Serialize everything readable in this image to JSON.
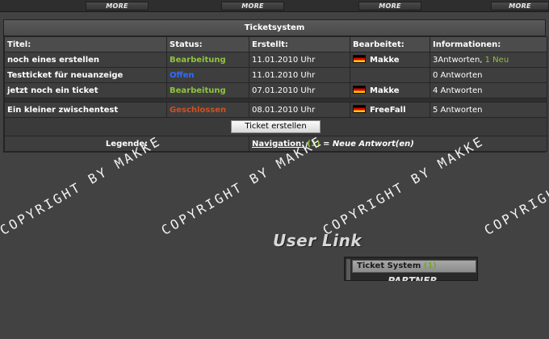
{
  "top_bar": {
    "more_buttons": [
      "MORE",
      "MORE",
      "MORE",
      "MORE"
    ]
  },
  "ticketsystem": {
    "title": "Ticketsystem",
    "columns": [
      "Titel:",
      "Status:",
      "Erstellt:",
      "Bearbeitet:",
      "Informationen:"
    ],
    "rows": [
      {
        "title": "noch eines erstellen",
        "status": "Bearbeitung",
        "created": "11.01.2010 Uhr",
        "editor": "Makke",
        "info": "3Antworten, ",
        "info_new": "1 Neu"
      },
      {
        "title": "Testticket für neuanzeige",
        "status": "Offen",
        "created": "11.01.2010 Uhr",
        "editor": "",
        "info": "0 Antworten",
        "info_new": ""
      },
      {
        "title": "jetzt noch ein ticket",
        "status": "Bearbeitung",
        "created": "07.01.2010 Uhr",
        "editor": "Makke",
        "info": "4 Antworten",
        "info_new": ""
      },
      {
        "title": "Ein kleiner zwischentest",
        "status": "Geschlossen",
        "created": "08.01.2010 Uhr",
        "editor": "FreeFall",
        "info": "5 Antworten",
        "info_new": ""
      }
    ],
    "create_button": "Ticket erstellen",
    "legend_label": "Legende:",
    "legend_nav": "Navigation:",
    "legend_count": "(1)",
    "legend_eq": " = ",
    "legend_new": "Neue Antwort(en)"
  },
  "watermark": "COPYRIGHT BY MAKKE",
  "user_link": {
    "heading": "User Link",
    "item_label": "Ticket System ",
    "item_count": "(1)",
    "partner": "PARTNER"
  },
  "colors": {
    "status_bearbeitung": "#8fc43c",
    "status_offen": "#2f6cff",
    "status_geschlossen": "#d0501e",
    "background": "#424242"
  }
}
